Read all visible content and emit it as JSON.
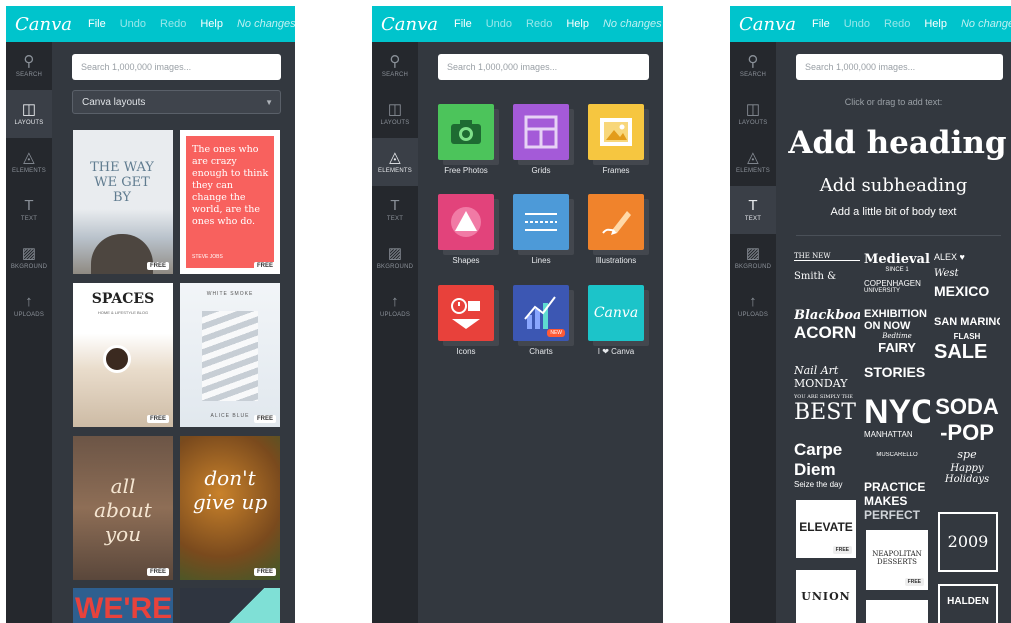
{
  "topbar": {
    "logo": "Canva",
    "file": "File",
    "undo": "Undo",
    "redo": "Redo",
    "help": "Help",
    "status": "No changes made"
  },
  "topbar_truncated": {
    "status_p2": "No changes m",
    "status_p3": "No changes"
  },
  "sidebar": [
    "SEARCH",
    "LAYOUTS",
    "ELEMENTS",
    "TEXT",
    "BKGROUND",
    "UPLOADS"
  ],
  "search_placeholder": "Search 1,000,000 images...",
  "layouts": {
    "dropdown": "Canva layouts",
    "free": "FREE",
    "tile1_title": "THE WAY WE GET BY",
    "tile2_text": "The ones who are crazy enough to think they can change the world, are the ones who do.",
    "tile2_author": "STEVE JOBS",
    "tile3_title": "SPACES",
    "tile3_sub": "HOME & LIFESTYLE BLOG",
    "tile4_top": "WHITE SMOKE",
    "tile4_bottom": "ALICE BLUE",
    "tile5_text": "all about you",
    "tile6_text": "don't give up",
    "tile7_text": "WE'RE"
  },
  "elements": [
    "Free Photos",
    "Grids",
    "Frames",
    "Shapes",
    "Lines",
    "Illustrations",
    "Icons",
    "Charts",
    "I ❤ Canva"
  ],
  "elements_new_badge": "NEW",
  "text_panel": {
    "hint": "Click or drag to add text:",
    "heading": "Add heading",
    "subheading": "Add subheading",
    "body": "Add a little bit of body text",
    "combos": [
      "THE NEW",
      "Medieval",
      "ALEX ♥",
      "Smith &",
      "SINCE 1",
      "West",
      "COPENHAGEN",
      "UNIVERSITY",
      "MEXICO",
      "Blackboard",
      "EXHIBITION",
      "ON NOW",
      "SAN MARINO",
      "ACORN",
      "Bedtime",
      "FAIRY",
      "STORIES",
      "FLASH",
      "SALE",
      "Nail Art",
      "MONDAY",
      "YOU ARE SIMPLY THE",
      "BEST",
      "NYC",
      "SODA",
      "-POP",
      "MANHATTAN",
      "Carpe",
      "Diem",
      "Seize the day",
      "MUSCARELLO",
      "spe",
      "PRACTICE",
      "MAKES",
      "PERFECT",
      "Happy",
      "Holidays",
      "ELEVATE",
      "NEAPOLITAN",
      "DESSERTS",
      "2009",
      "UNION",
      "HALDEN",
      "FREE"
    ]
  },
  "colors": {
    "accent": "#00c4cc",
    "panel": "#33383f",
    "rail": "#25282d"
  }
}
